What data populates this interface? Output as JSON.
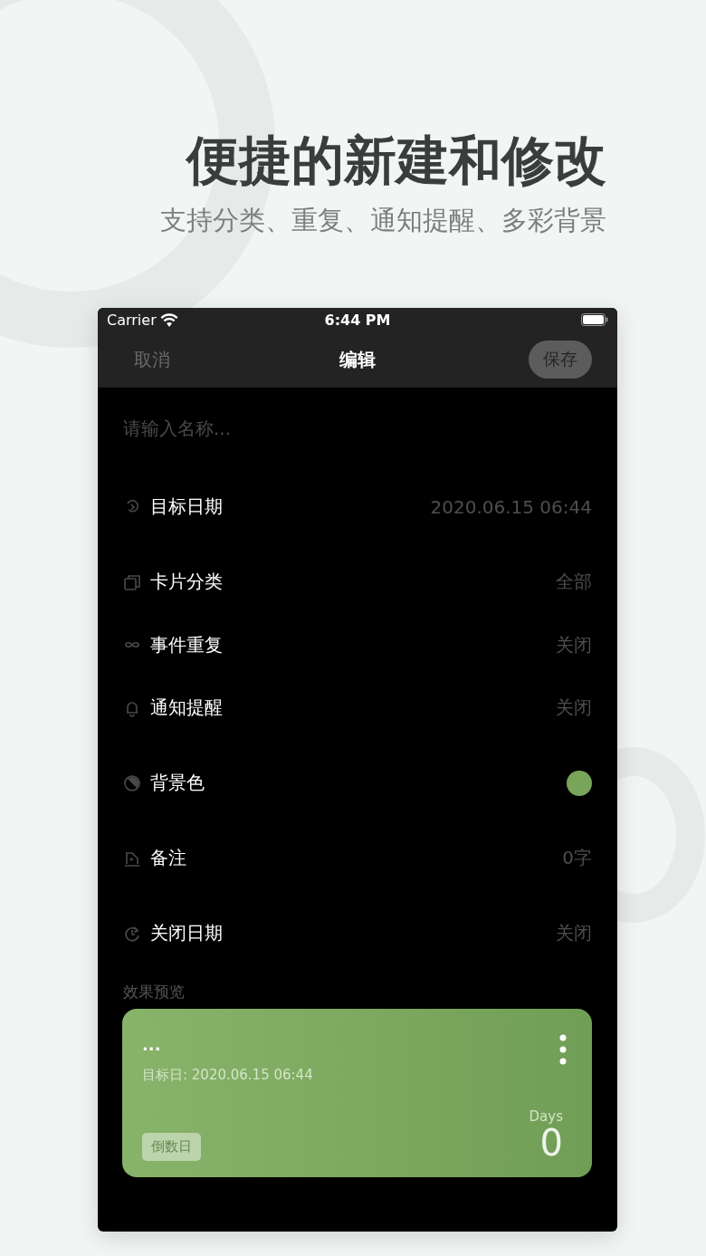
{
  "headline": {
    "title": "便捷的新建和修改",
    "subtitle": "支持分类、重复、通知提醒、多彩背景"
  },
  "status_bar": {
    "carrier": "Carrier",
    "time": "6:44 PM"
  },
  "nav": {
    "cancel": "取消",
    "title": "编辑",
    "save": "保存"
  },
  "name_field": {
    "placeholder": "请输入名称..."
  },
  "rows": [
    {
      "kind": "value",
      "label": "目标日期",
      "value": "2020.06.15 06:44"
    },
    {
      "kind": "value",
      "label": "卡片分类",
      "value": "全部"
    },
    {
      "kind": "value",
      "label": "事件重复",
      "value": "关闭"
    },
    {
      "kind": "value",
      "label": "通知提醒",
      "value": "关闭"
    },
    {
      "kind": "color",
      "label": "背景色",
      "color": "#78a55a"
    },
    {
      "kind": "value",
      "label": "备注",
      "value": "0字"
    },
    {
      "kind": "value",
      "label": "关闭日期",
      "value": "关闭"
    }
  ],
  "preview": {
    "label": "效果预览",
    "card": {
      "title": "...",
      "date": "目标日: 2020.06.15 06:44",
      "tag": "倒数日",
      "unit": "Days",
      "count": "0"
    }
  }
}
